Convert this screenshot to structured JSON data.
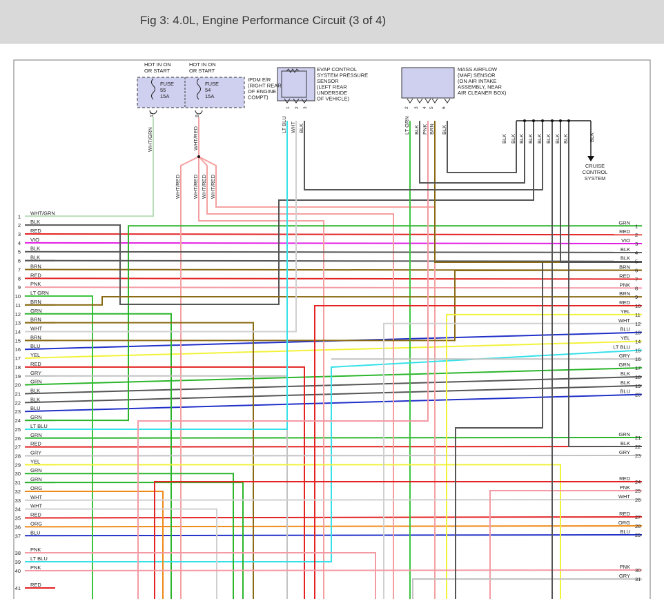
{
  "figure_title": "Fig 3: 4.0L, Engine Performance Circuit (3 of 4)",
  "colors": {
    "GRN": "#2bb52b",
    "LT GRN": "#3cc43c",
    "RED": "#e32222",
    "VIO": "#e21de3",
    "BLK": "#555555",
    "BRN": "#8a6a14",
    "PNK": "#f49aa4",
    "YEL": "#f2f23a",
    "GRY": "#c2c2c2",
    "BLU": "#2030c8",
    "LT BLU": "#35e0e8",
    "ORG": "#f08a18",
    "WHT": "#d0d0d0",
    "WHT/RED": "#f5a0a0",
    "WHT/GRN": "#b8dcb8"
  },
  "top_components": {
    "fuse_hot_left": "HOT IN ON\nOR START",
    "fuse_hot_right": "HOT IN ON\nOR START",
    "fuse55": "FUSE\n55\n15A",
    "fuse54": "FUSE\n54\n15A",
    "fuse55_pin": "17",
    "fuse54_pin": "8",
    "ipdm_label": "IPDM E/R\n(RIGHT REAR\nOF ENGINE\nCOMPT)",
    "evap_label": "EVAP CONTROL\nSYSTEM PRESSURE\nSENSOR\n(LEFT REAR\nUNDERSIDE\nOF VEHICLE)",
    "evap_pins": [
      "1",
      "2",
      "3"
    ],
    "maf_label": "MASS AIRFLOW\n(MAF) SENSOR\n(ON AIR INTAKE\nASSEMBLY, NEAR\nAIR CLEANER BOX)",
    "maf_pins": [
      "2",
      "3",
      "4",
      "5",
      "6"
    ],
    "cruise_label": "CRUISE\nCONTROL\nSYSTEM"
  },
  "vertical_labels": {
    "wht_grn": "WHT/GRN",
    "wht_red_top": "WHT/RED",
    "wht_red_branches": [
      "WHT/RED",
      "WHT/RED",
      "WHT/RED",
      "WHT/RED"
    ],
    "evap_wires": [
      "LT BLU",
      "WHT",
      "BLK"
    ],
    "maf_wires": [
      "LT GRN",
      "BLK",
      "PNK",
      "BRN",
      "BLK"
    ],
    "blk_bus": [
      "BLK",
      "BLK",
      "BLK",
      "BLK",
      "BLK",
      "BLK",
      "BLK",
      "BLK"
    ],
    "cruise_wire": "BLK"
  },
  "left_connector": [
    {
      "pin": "1",
      "color": "WHT/GRN"
    },
    {
      "pin": "2",
      "color": "BLK"
    },
    {
      "pin": "3",
      "color": "RED"
    },
    {
      "pin": "4",
      "color": "VIO"
    },
    {
      "pin": "5",
      "color": "BLK"
    },
    {
      "pin": "6",
      "color": "BLK"
    },
    {
      "pin": "7",
      "color": "BRN"
    },
    {
      "pin": "8",
      "color": "RED"
    },
    {
      "pin": "9",
      "color": "PNK"
    },
    {
      "pin": "10",
      "color": "LT GRN"
    },
    {
      "pin": "11",
      "color": "BRN"
    },
    {
      "pin": "12",
      "color": "GRN"
    },
    {
      "pin": "13",
      "color": "BRN"
    },
    {
      "pin": "14",
      "color": "WHT"
    },
    {
      "pin": "15",
      "color": "BRN"
    },
    {
      "pin": "16",
      "color": "BLU"
    },
    {
      "pin": "17",
      "color": "YEL"
    },
    {
      "pin": "18",
      "color": "RED"
    },
    {
      "pin": "19",
      "color": "GRY"
    },
    {
      "pin": "20",
      "color": "GRN"
    },
    {
      "pin": "21",
      "color": "BLK"
    },
    {
      "pin": "22",
      "color": "BLK"
    },
    {
      "pin": "23",
      "color": "BLU"
    },
    {
      "pin": "24",
      "color": "GRN"
    },
    {
      "pin": "25",
      "color": "LT BLU"
    },
    {
      "pin": "26",
      "color": "GRN"
    },
    {
      "pin": "27",
      "color": "RED"
    },
    {
      "pin": "28",
      "color": "GRY"
    },
    {
      "pin": "29",
      "color": "YEL"
    },
    {
      "pin": "30",
      "color": "GRN"
    },
    {
      "pin": "31",
      "color": "GRN"
    },
    {
      "pin": "32",
      "color": "ORG"
    },
    {
      "pin": "33",
      "color": "WHT"
    },
    {
      "pin": "34",
      "color": "WHT"
    },
    {
      "pin": "35",
      "color": "RED"
    },
    {
      "pin": "36",
      "color": "ORG"
    },
    {
      "pin": "37",
      "color": "BLU"
    },
    {
      "pin": "38",
      "color": "PNK"
    },
    {
      "pin": "39",
      "color": "LT BLU"
    },
    {
      "pin": "40",
      "color": "PNK"
    },
    {
      "pin": "41",
      "color": "RED"
    }
  ],
  "right_connector": [
    {
      "pin": "1",
      "color": "GRN"
    },
    {
      "pin": "2",
      "color": "RED"
    },
    {
      "pin": "3",
      "color": "VIO"
    },
    {
      "pin": "4",
      "color": "BLK"
    },
    {
      "pin": "5",
      "color": "BLK"
    },
    {
      "pin": "6",
      "color": "BRN"
    },
    {
      "pin": "7",
      "color": "RED"
    },
    {
      "pin": "8",
      "color": "PNK"
    },
    {
      "pin": "9",
      "color": "BRN"
    },
    {
      "pin": "10",
      "color": "RED"
    },
    {
      "pin": "11",
      "color": "YEL"
    },
    {
      "pin": "12",
      "color": "WHT"
    },
    {
      "pin": "13",
      "color": "BLU"
    },
    {
      "pin": "14",
      "color": "YEL"
    },
    {
      "pin": "15",
      "color": "LT BLU"
    },
    {
      "pin": "16",
      "color": "GRY"
    },
    {
      "pin": "17",
      "color": "GRN"
    },
    {
      "pin": "18",
      "color": "BLK"
    },
    {
      "pin": "19",
      "color": "BLK"
    },
    {
      "pin": "20",
      "color": "BLU"
    },
    {
      "pin": "21",
      "color": "GRN"
    },
    {
      "pin": "22",
      "color": "BLK"
    },
    {
      "pin": "23",
      "color": "GRY"
    },
    {
      "pin": "24",
      "color": "RED"
    },
    {
      "pin": "25",
      "color": "PNK"
    },
    {
      "pin": "26",
      "color": "WHT"
    },
    {
      "pin": "27",
      "color": "RED"
    },
    {
      "pin": "28",
      "color": "ORG"
    },
    {
      "pin": "29",
      "color": "BLU"
    },
    {
      "pin": "30",
      "color": "PNK"
    },
    {
      "pin": "31",
      "color": "GRY"
    }
  ]
}
